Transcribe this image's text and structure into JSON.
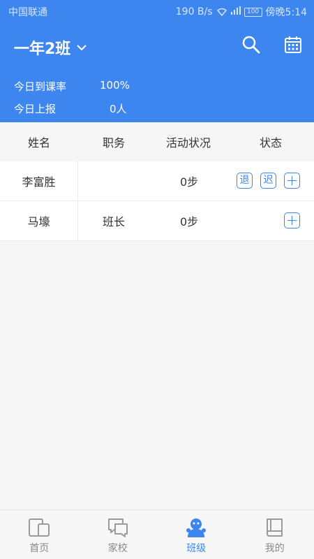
{
  "statusbar": {
    "carrier": "中国联通",
    "speed": "190 B/s",
    "battery": "100",
    "time": "傍晚5:14"
  },
  "header": {
    "class_name": "一年2班",
    "stats": [
      {
        "label": "今日到课率",
        "value": "100%"
      },
      {
        "label": "今日上报",
        "value": "0人"
      }
    ]
  },
  "table": {
    "columns": [
      "姓名",
      "职务",
      "活动状况",
      "状态"
    ],
    "rows": [
      {
        "name": "李富胜",
        "role": "",
        "activity": "0步",
        "tags": [
          "退",
          "迟"
        ]
      },
      {
        "name": "马壕",
        "role": "班长",
        "activity": "0步",
        "tags": []
      }
    ]
  },
  "tabs": [
    {
      "label": "首页",
      "icon": "home-icon",
      "active": false
    },
    {
      "label": "家校",
      "icon": "chat-icon",
      "active": false
    },
    {
      "label": "班级",
      "icon": "class-icon",
      "active": true
    },
    {
      "label": "我的",
      "icon": "book-icon",
      "active": false
    }
  ],
  "colors": {
    "accent": "#3d86f0",
    "inactive": "#888888"
  }
}
